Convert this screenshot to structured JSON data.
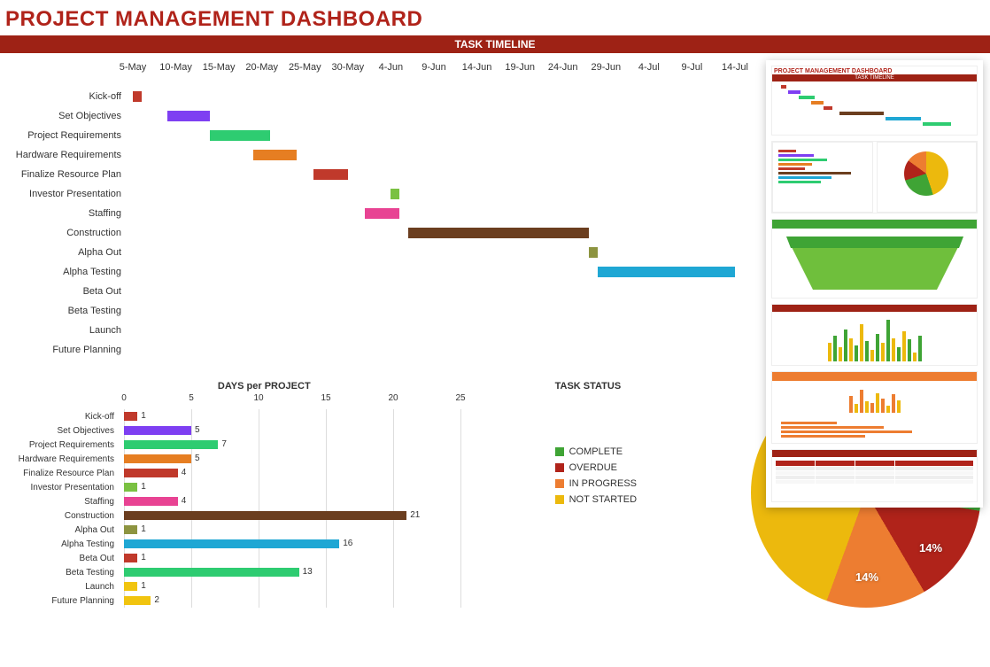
{
  "title": "PROJECT MANAGEMENT DASHBOARD",
  "timeline_header": "TASK TIMELINE",
  "chart_data": {
    "gantt": {
      "type": "gantt",
      "date_ticks": [
        "5-May",
        "10-May",
        "15-May",
        "20-May",
        "25-May",
        "30-May",
        "4-Jun",
        "9-Jun",
        "14-Jun",
        "19-Jun",
        "24-Jun",
        "29-Jun",
        "4-Jul",
        "9-Jul",
        "14-Jul"
      ],
      "x_start_day": 0,
      "x_end_day": 70,
      "tasks": [
        {
          "name": "Kick-off",
          "start": 0,
          "dur": 1,
          "color": "#c0392b"
        },
        {
          "name": "Set Objectives",
          "start": 4,
          "dur": 5,
          "color": "#7e3ff2"
        },
        {
          "name": "Project Requirements",
          "start": 9,
          "dur": 7,
          "color": "#2ecc71"
        },
        {
          "name": "Hardware Requirements",
          "start": 14,
          "dur": 5,
          "color": "#e67e22"
        },
        {
          "name": "Finalize Resource Plan",
          "start": 21,
          "dur": 4,
          "color": "#c0392b"
        },
        {
          "name": "Investor Presentation",
          "start": 30,
          "dur": 1,
          "color": "#7ac142"
        },
        {
          "name": "Staffing",
          "start": 27,
          "dur": 4,
          "color": "#e84393"
        },
        {
          "name": "Construction",
          "start": 32,
          "dur": 21,
          "color": "#6b3e1f"
        },
        {
          "name": "Alpha Out",
          "start": 53,
          "dur": 1,
          "color": "#8d9440"
        },
        {
          "name": "Alpha Testing",
          "start": 54,
          "dur": 16,
          "color": "#1fa7d4"
        },
        {
          "name": "Beta Out",
          "start": null,
          "dur": 0,
          "color": "#c0392b"
        },
        {
          "name": "Beta Testing",
          "start": null,
          "dur": 0,
          "color": "#2ecc71"
        },
        {
          "name": "Launch",
          "start": null,
          "dur": 0,
          "color": "#f1c40f"
        },
        {
          "name": "Future Planning",
          "start": null,
          "dur": 0,
          "color": "#f1c40f"
        }
      ]
    },
    "days_per_project": {
      "type": "bar",
      "title": "DAYS per PROJECT",
      "xlabel": "",
      "ylabel": "",
      "xlim": [
        0,
        25
      ],
      "ticks": [
        0,
        5,
        10,
        15,
        20,
        25
      ],
      "categories": [
        "Kick-off",
        "Set Objectives",
        "Project Requirements",
        "Hardware Requirements",
        "Finalize Resource Plan",
        "Investor Presentation",
        "Staffing",
        "Construction",
        "Alpha Out",
        "Alpha Testing",
        "Beta Out",
        "Beta Testing",
        "Launch",
        "Future Planning"
      ],
      "values": [
        1,
        5,
        7,
        5,
        4,
        1,
        4,
        21,
        1,
        16,
        1,
        13,
        1,
        2
      ],
      "colors": [
        "#c0392b",
        "#7e3ff2",
        "#2ecc71",
        "#e67e22",
        "#c0392b",
        "#7ac142",
        "#e84393",
        "#6b3e1f",
        "#8d9440",
        "#1fa7d4",
        "#c0392b",
        "#2ecc71",
        "#f1c40f",
        "#f1c40f"
      ]
    },
    "task_status": {
      "type": "pie",
      "title": "TASK STATUS",
      "series": [
        {
          "name": "COMPLETE",
          "value": 29,
          "color": "#3fa435"
        },
        {
          "name": "OVERDUE",
          "value": 14,
          "color": "#b0231a"
        },
        {
          "name": "IN PROGRESS",
          "value": 14,
          "color": "#ed7d31"
        },
        {
          "name": "NOT STARTED",
          "value": 43,
          "color": "#ecb90d"
        }
      ],
      "visible_labels": [
        "43%",
        "14%",
        "14%"
      ]
    }
  }
}
